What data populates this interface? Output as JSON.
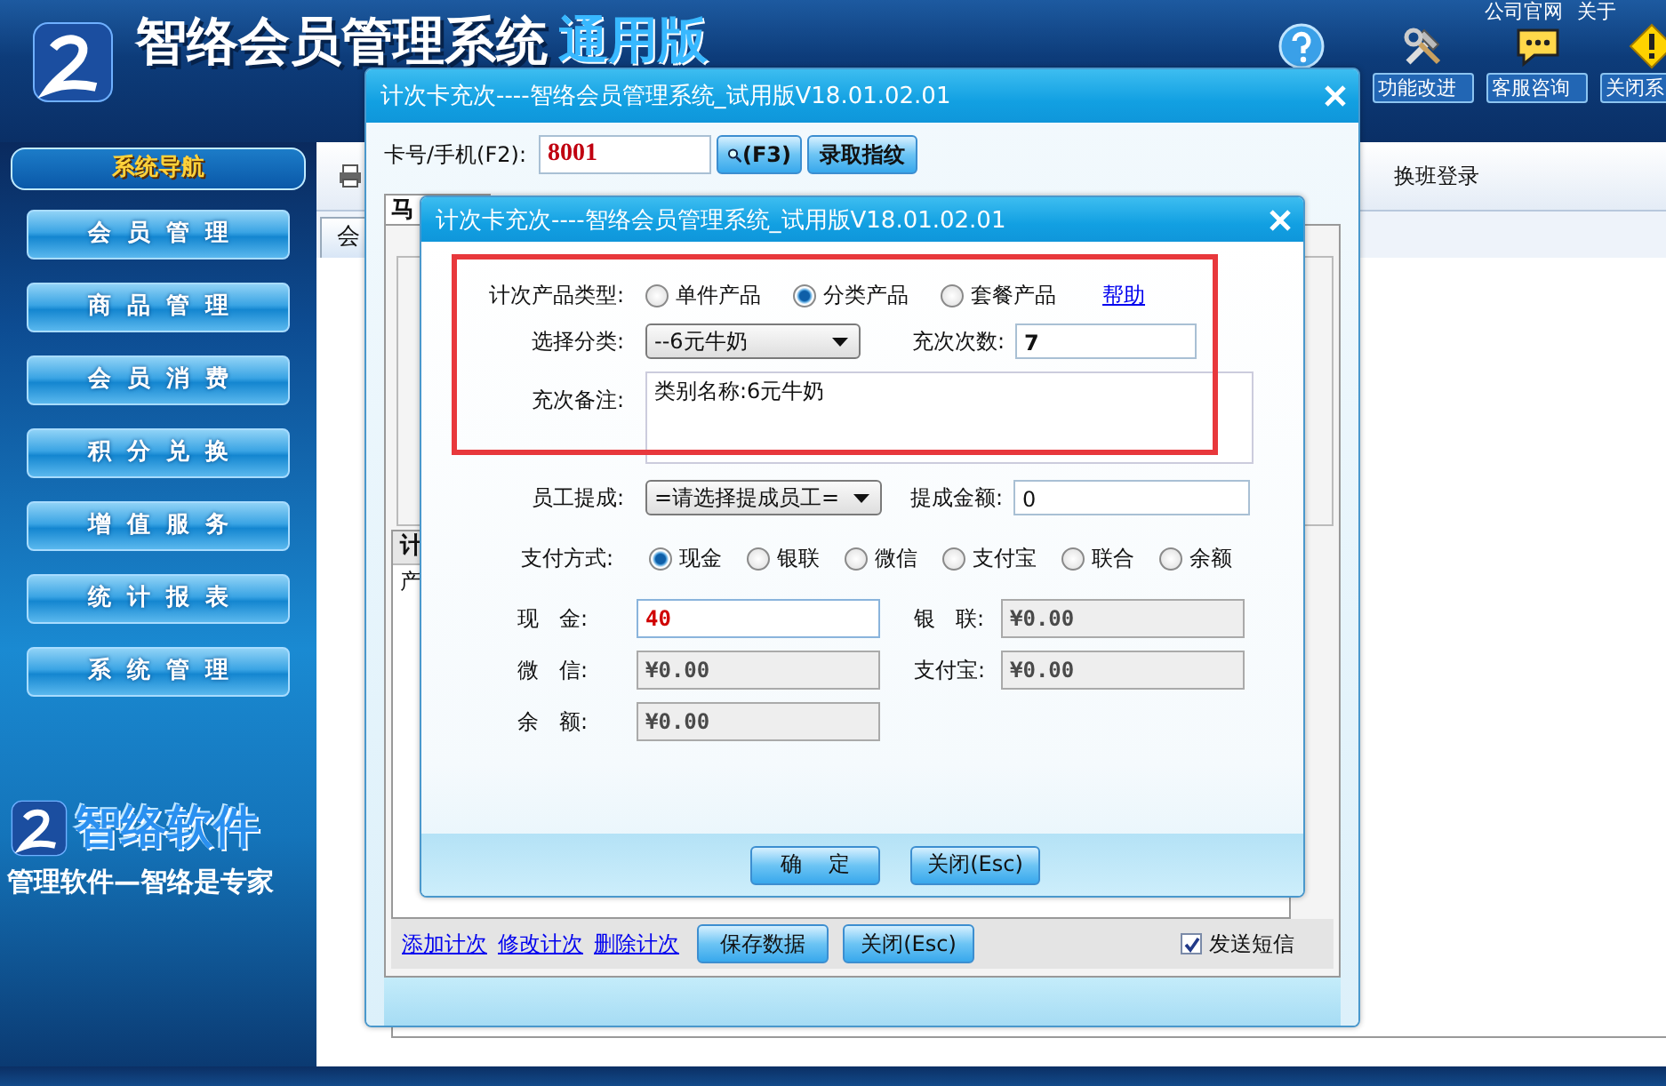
{
  "header": {
    "title": "智络会员管理系统",
    "edition": "通用版",
    "top_links": [
      "公司官网",
      "关于"
    ],
    "tools": [
      {
        "kind": "help"
      },
      {
        "kind": "tools",
        "label": "功能改进"
      },
      {
        "kind": "chat",
        "label": "客服咨询"
      },
      {
        "kind": "warning",
        "label": "关闭系"
      }
    ]
  },
  "sidebar": {
    "title": "系统导航",
    "items": [
      "会员管理",
      "商品管理",
      "会员消费",
      "积分兑换",
      "增值服务",
      "统计报表",
      "系统管理"
    ],
    "brand": "智络软件",
    "slogan": "管理软件—智络是专家"
  },
  "main": {
    "toolbar_item": "换班登录",
    "tab": "会"
  },
  "outer_dialog": {
    "title": "计次卡充次----智络会员管理系统_试用版V18.01.02.01",
    "card_label": "卡号/手机(F2):",
    "card_value": "8001",
    "search_button": "(F3)",
    "fingerprint_button": "录取指纹",
    "tab": "马",
    "list_header": "计",
    "list_row": "产",
    "links": [
      "添加计次",
      "修改计次",
      "删除计次"
    ],
    "buttons": [
      "保存数据",
      "关闭(Esc)"
    ],
    "send_sms": {
      "label": "发送短信",
      "checked": true
    }
  },
  "inner_dialog": {
    "title": "计次卡充次----智络会员管理系统_试用版V18.01.02.01",
    "product_type": {
      "label": "计次产品类型:",
      "options": [
        {
          "label": "单件产品",
          "selected": false
        },
        {
          "label": "分类产品",
          "selected": true
        },
        {
          "label": "套餐产品",
          "selected": false
        }
      ],
      "help_link": "帮助"
    },
    "category": {
      "label": "选择分类:",
      "value": "--6元牛奶"
    },
    "count": {
      "label": "充次次数:",
      "value": "7"
    },
    "remark": {
      "label": "充次备注:",
      "value": "类别名称:6元牛奶"
    },
    "staff": {
      "label": "员工提成:",
      "value": "=请选择提成员工="
    },
    "commission": {
      "label": "提成金额:",
      "value": "0"
    },
    "payment": {
      "label": "支付方式:",
      "options": [
        {
          "label": "现金",
          "selected": true
        },
        {
          "label": "银联",
          "selected": false
        },
        {
          "label": "微信",
          "selected": false
        },
        {
          "label": "支付宝",
          "selected": false
        },
        {
          "label": "联合",
          "selected": false
        },
        {
          "label": "余额",
          "selected": false
        }
      ]
    },
    "amounts": [
      {
        "label": "现   金:",
        "value": "40",
        "disabled": false
      },
      {
        "label": "银   联:",
        "value": "¥0.00",
        "disabled": true
      },
      {
        "label": "微   信:",
        "value": "¥0.00",
        "disabled": true
      },
      {
        "label": "支付宝:",
        "value": "¥0.00",
        "disabled": true
      },
      {
        "label": "余   额:",
        "value": "¥0.00",
        "disabled": true
      }
    ],
    "buttons": [
      "确    定",
      "关闭(Esc)"
    ]
  }
}
